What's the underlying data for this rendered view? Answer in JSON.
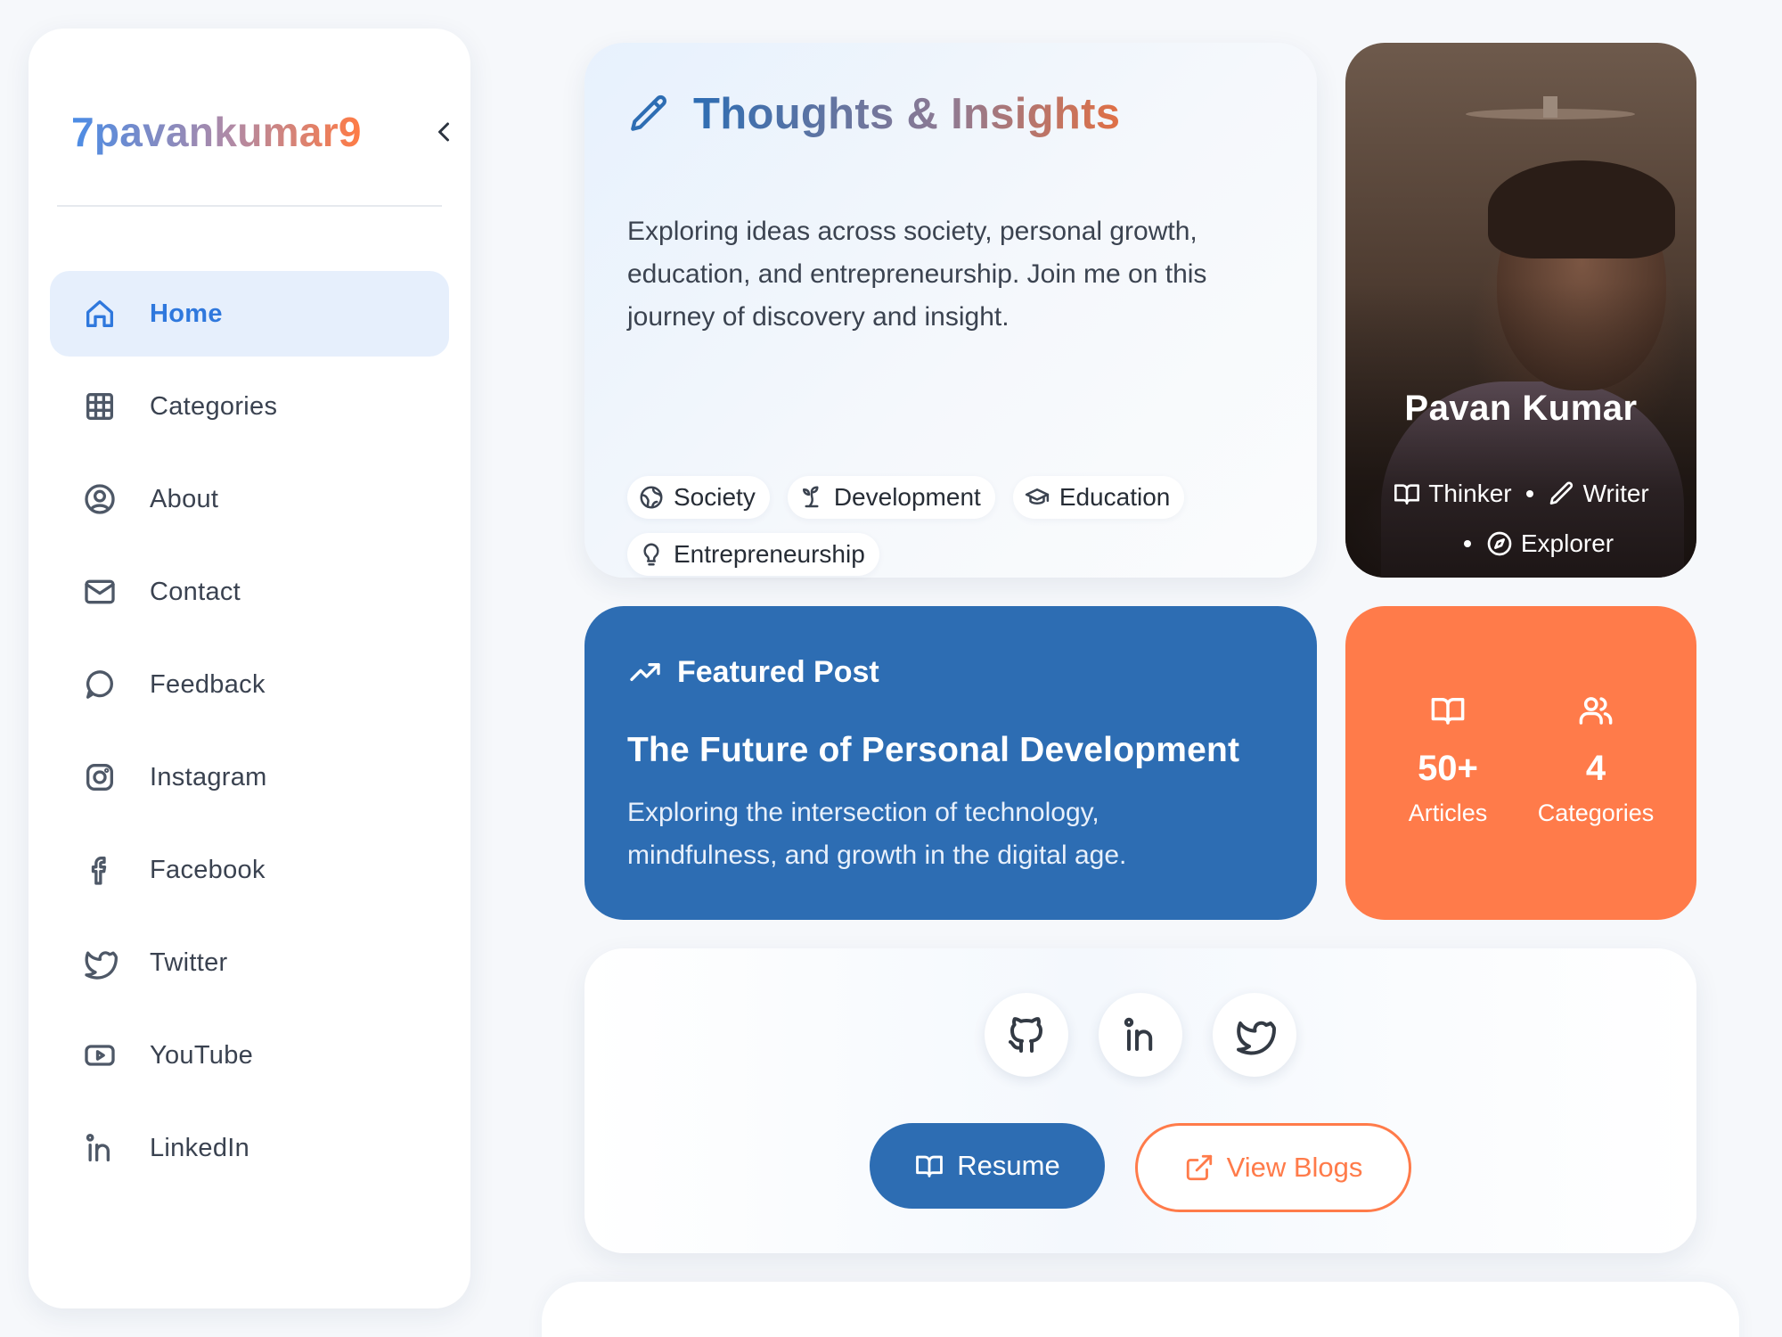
{
  "sidebar": {
    "brand": "7pavankumar9",
    "collapse_icon": "chevron-left-icon",
    "items": [
      {
        "label": "Home",
        "icon": "home-icon",
        "active": true
      },
      {
        "label": "Categories",
        "icon": "grid-icon"
      },
      {
        "label": "About",
        "icon": "user-circle-icon"
      },
      {
        "label": "Contact",
        "icon": "mail-icon"
      },
      {
        "label": "Feedback",
        "icon": "message-circle-icon"
      },
      {
        "label": "Instagram",
        "icon": "instagram-icon"
      },
      {
        "label": "Facebook",
        "icon": "facebook-icon"
      },
      {
        "label": "Twitter",
        "icon": "twitter-icon"
      },
      {
        "label": "YouTube",
        "icon": "youtube-icon"
      },
      {
        "label": "LinkedIn",
        "icon": "linkedin-icon"
      }
    ]
  },
  "hero": {
    "title": "Thoughts & Insights",
    "icon": "pen-icon",
    "description": "Exploring ideas across society, personal growth, education, and entrepreneurship. Join me on this journey of discovery and insight.",
    "tags": [
      {
        "label": "Society",
        "icon": "globe-icon"
      },
      {
        "label": "Development",
        "icon": "sprout-icon"
      },
      {
        "label": "Education",
        "icon": "graduation-cap-icon"
      },
      {
        "label": "Entrepreneurship",
        "icon": "lightbulb-icon"
      }
    ]
  },
  "profile": {
    "name": "Pavan Kumar",
    "roles": [
      {
        "label": "Thinker",
        "icon": "book-open-icon"
      },
      {
        "label": "Writer",
        "icon": "pen-icon"
      },
      {
        "label": "Explorer",
        "icon": "compass-icon"
      }
    ]
  },
  "featured": {
    "label": "Featured Post",
    "icon": "trending-up-icon",
    "title": "The Future of Personal Development",
    "description": "Exploring the intersection of technology, mindfulness, and growth in the digital age."
  },
  "stats": [
    {
      "value": "50+",
      "label": "Articles",
      "icon": "book-open-icon"
    },
    {
      "value": "4",
      "label": "Categories",
      "icon": "users-icon"
    }
  ],
  "socials": {
    "icons": [
      "github-icon",
      "linkedin-icon",
      "twitter-icon"
    ],
    "resume_label": "Resume",
    "view_blogs_label": "View Blogs"
  },
  "colors": {
    "primary": "#2d6db3",
    "accent": "#ff7b4a",
    "active_nav_bg": "#e6effc",
    "active_nav_text": "#2f78dd",
    "page_bg": "#f6f8fb"
  }
}
